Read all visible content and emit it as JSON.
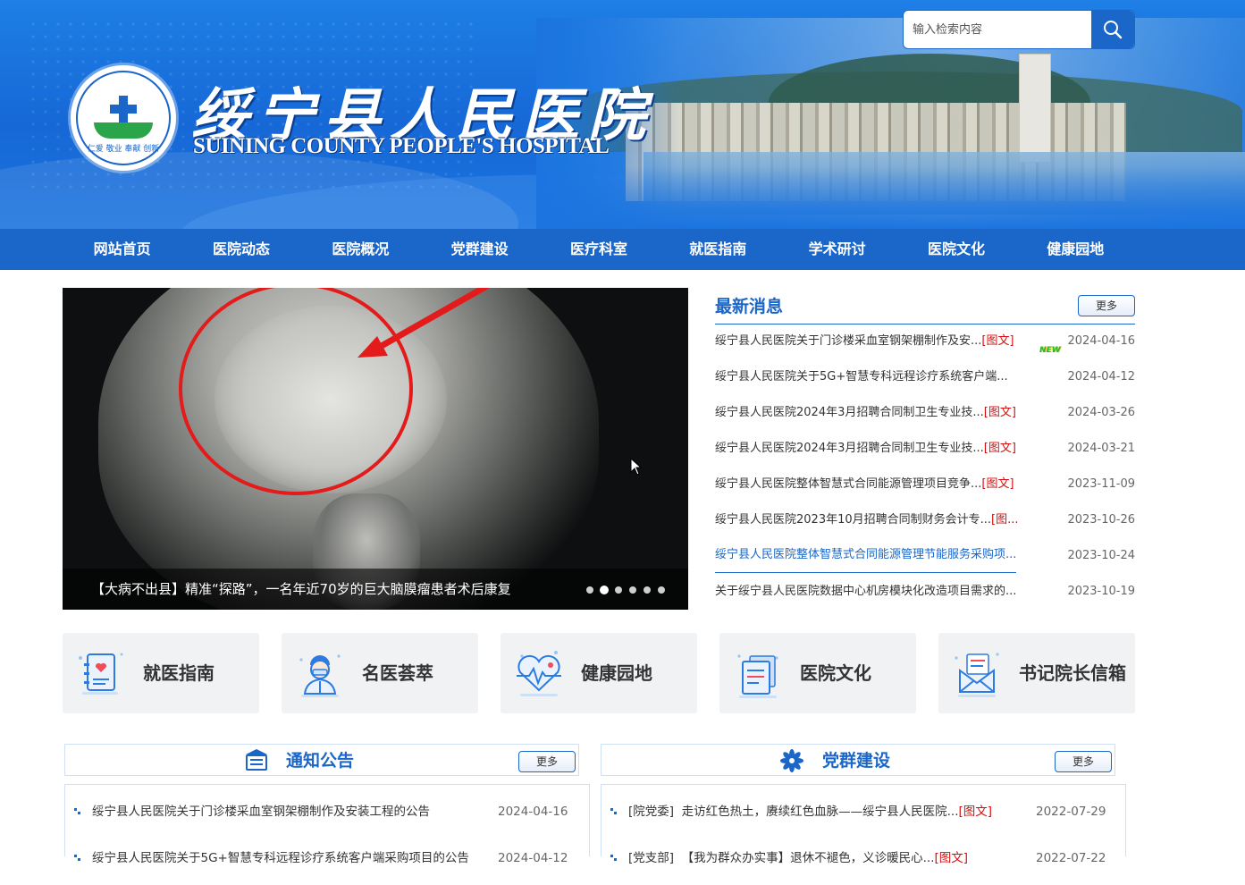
{
  "header": {
    "title_cn": "绥宁县人民医院",
    "title_en": "SUINING COUNTY PEOPLE'S HOSPITAL",
    "logo_motto": "仁爱 敬业 奉献 创新",
    "search_placeholder": "输入检索内容"
  },
  "nav": [
    "网站首页",
    "医院动态",
    "医院概况",
    "党群建设",
    "医疗科室",
    "就医指南",
    "学术研讨",
    "医院文化",
    "健康园地"
  ],
  "slider": {
    "caption": "【大病不出县】精准“探路”，一名年近70岁的巨大脑膜瘤患者术后康复",
    "dot_count": 6,
    "active_dot": 2
  },
  "latest": {
    "title": "最新消息",
    "more": "更多",
    "new_badge": "NEW",
    "items": [
      {
        "title": "绥宁县人民医院关于门诊楼采血室钢架棚制作及安...",
        "tag": "[图文]",
        "date": "2024-04-16"
      },
      {
        "title": "绥宁县人民医院关于5G+智慧专科远程诊疗系统客户端...",
        "tag": "",
        "date": "2024-04-12"
      },
      {
        "title": "绥宁县人民医院2024年3月招聘合同制卫生专业技...",
        "tag": "[图文]",
        "date": "2024-03-26"
      },
      {
        "title": "绥宁县人民医院2024年3月招聘合同制卫生专业技...",
        "tag": "[图文]",
        "date": "2024-03-21"
      },
      {
        "title": "绥宁县人民医院整体智慧式合同能源管理项目竞争...",
        "tag": "[图文]",
        "date": "2023-11-09"
      },
      {
        "title": "绥宁县人民医院2023年10月招聘合同制财务会计专...",
        "tag": "[图...",
        "date": "2023-10-26"
      },
      {
        "title": "绥宁县人民医院整体智慧式合同能源管理节能服务采购项...",
        "tag": "",
        "date": "2023-10-24"
      },
      {
        "title": "关于绥宁县人民医院数据中心机房模块化改造项目需求的...",
        "tag": "",
        "date": "2023-10-19"
      }
    ]
  },
  "quick_links": [
    "就医指南",
    "名医荟萃",
    "健康园地",
    "医院文化",
    "书记院长信箱"
  ],
  "notice": {
    "title": "通知公告",
    "more": "更多",
    "items": [
      {
        "title": "绥宁县人民医院关于门诊楼采血室钢架棚制作及安装工程的公告",
        "date": "2024-04-16"
      },
      {
        "title": "绥宁县人民医院关于5G+智慧专科远程诊疗系统客户端采购项目的公告",
        "date": "2024-04-12"
      }
    ]
  },
  "party": {
    "title": "党群建设",
    "more": "更多",
    "items": [
      {
        "category": "[院党委]",
        "title": "走访红色热土，赓续红色血脉——绥宁县人民医院...",
        "tag": "[图文]",
        "date": "2022-07-29"
      },
      {
        "category": "[党支部]",
        "title": "【我为群众办实事】退休不褪色，义诊暖民心...",
        "tag": "[图文]",
        "date": "2022-07-22"
      }
    ]
  },
  "colors": {
    "primary": "#1a66c9",
    "tag_red": "#d40f0f"
  }
}
